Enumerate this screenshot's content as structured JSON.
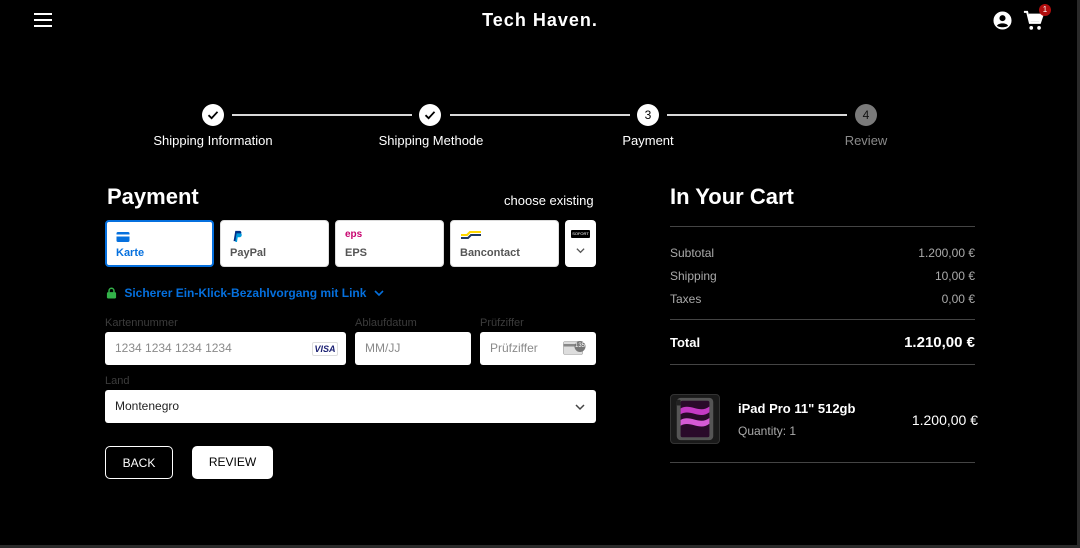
{
  "header": {
    "brand": "Tech Haven.",
    "cart_count": "1"
  },
  "stepper": [
    {
      "label": "Shipping Information",
      "state": "done"
    },
    {
      "label": "Shipping Methode",
      "state": "done"
    },
    {
      "label": "Payment",
      "number": "3",
      "state": "current"
    },
    {
      "label": "Review",
      "number": "4",
      "state": "pending"
    }
  ],
  "payment": {
    "title": "Payment",
    "choose_existing": "choose existing",
    "methods": [
      {
        "label": "Karte",
        "icon": "card-icon",
        "selected": true
      },
      {
        "label": "PayPal",
        "icon": "paypal-icon"
      },
      {
        "label": "EPS",
        "icon": "eps-icon",
        "icon_text": "eps"
      },
      {
        "label": "Bancontact",
        "icon": "bancontact-icon"
      }
    ],
    "more_badge": "SOFORT",
    "link_text": "Sicherer Ein-Klick-Bezahlvorgang mit Link",
    "card_number_label": "Kartennummer",
    "card_number_placeholder": "1234 1234 1234 1234",
    "card_brand": "VISA",
    "expiry_label": "Ablaufdatum",
    "expiry_placeholder": "MM/JJ",
    "cvc_label": "Prüfziffer",
    "cvc_placeholder": "Prüfziffer",
    "cvc_icon_text": "135",
    "country_label": "Land",
    "country_value": "Montenegro",
    "back_label": "BACK",
    "review_label": "REVIEW",
    "accent_color": "#0570de",
    "link_green": "#33b249"
  },
  "cart": {
    "title": "In Your Cart",
    "subtotal_label": "Subtotal",
    "subtotal_value": "1.200,00 €",
    "shipping_label": "Shipping",
    "shipping_value": "10,00 €",
    "taxes_label": "Taxes",
    "taxes_value": "0,00 €",
    "total_label": "Total",
    "total_value": "1.210,00 €",
    "item": {
      "name": "iPad Pro 11\" 512gb",
      "quantity": "Quantity: 1",
      "price": "1.200,00 €"
    }
  }
}
